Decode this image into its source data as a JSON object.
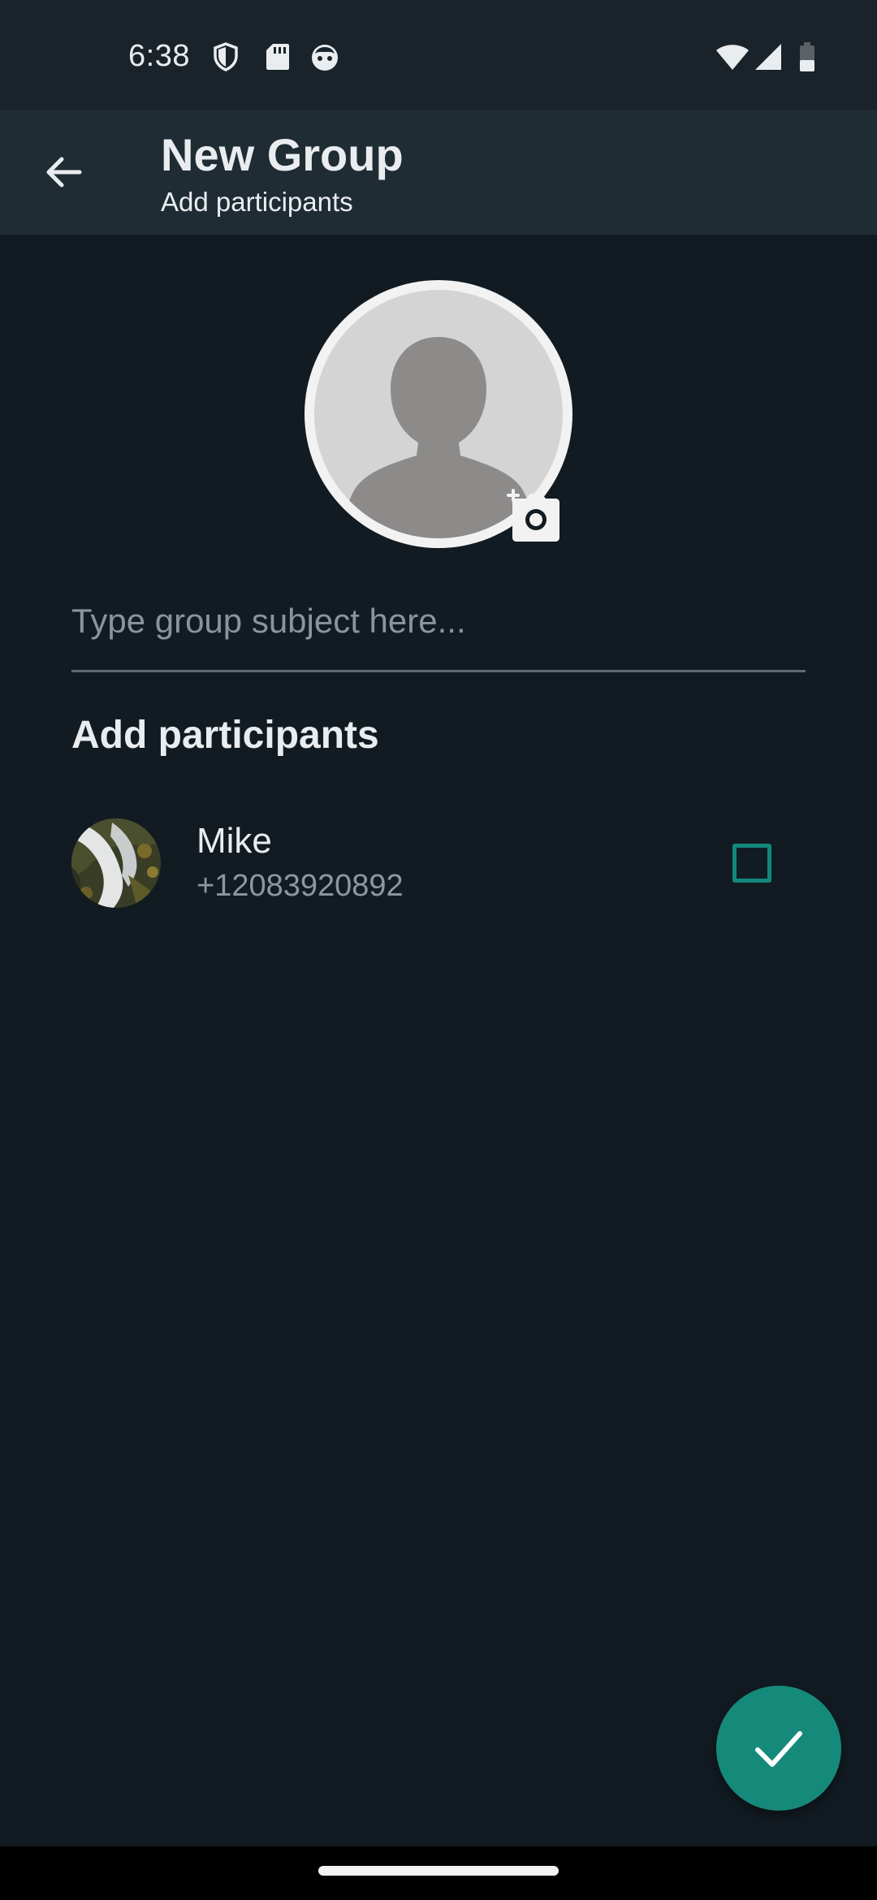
{
  "status_bar": {
    "time": "6:38",
    "left_icons": [
      "shield-icon",
      "sd-card-icon",
      "assistant-face-icon"
    ],
    "right_icons": [
      "wifi-icon",
      "cell-signal-icon",
      "battery-icon"
    ]
  },
  "app_bar": {
    "title": "New Group",
    "subtitle": "Add participants",
    "back_icon": "arrow-back-icon"
  },
  "group_photo": {
    "placeholder_icon": "person-silhouette-icon",
    "badge_icon": "add-camera-icon"
  },
  "subject_input": {
    "placeholder": "Type group subject here...",
    "value": ""
  },
  "participants_section": {
    "title": "Add participants",
    "contacts": [
      {
        "name": "Mike",
        "phone": "+12083920892",
        "checked": false
      }
    ]
  },
  "fab": {
    "icon": "check-icon"
  },
  "colors": {
    "background": "#121b22",
    "status_bar": "#1b232a",
    "app_bar": "#1f2c34",
    "accent": "#168a7a",
    "checkbox_border": "#11887c",
    "primary_text": "#e9edef",
    "secondary_text": "#8d989e"
  }
}
